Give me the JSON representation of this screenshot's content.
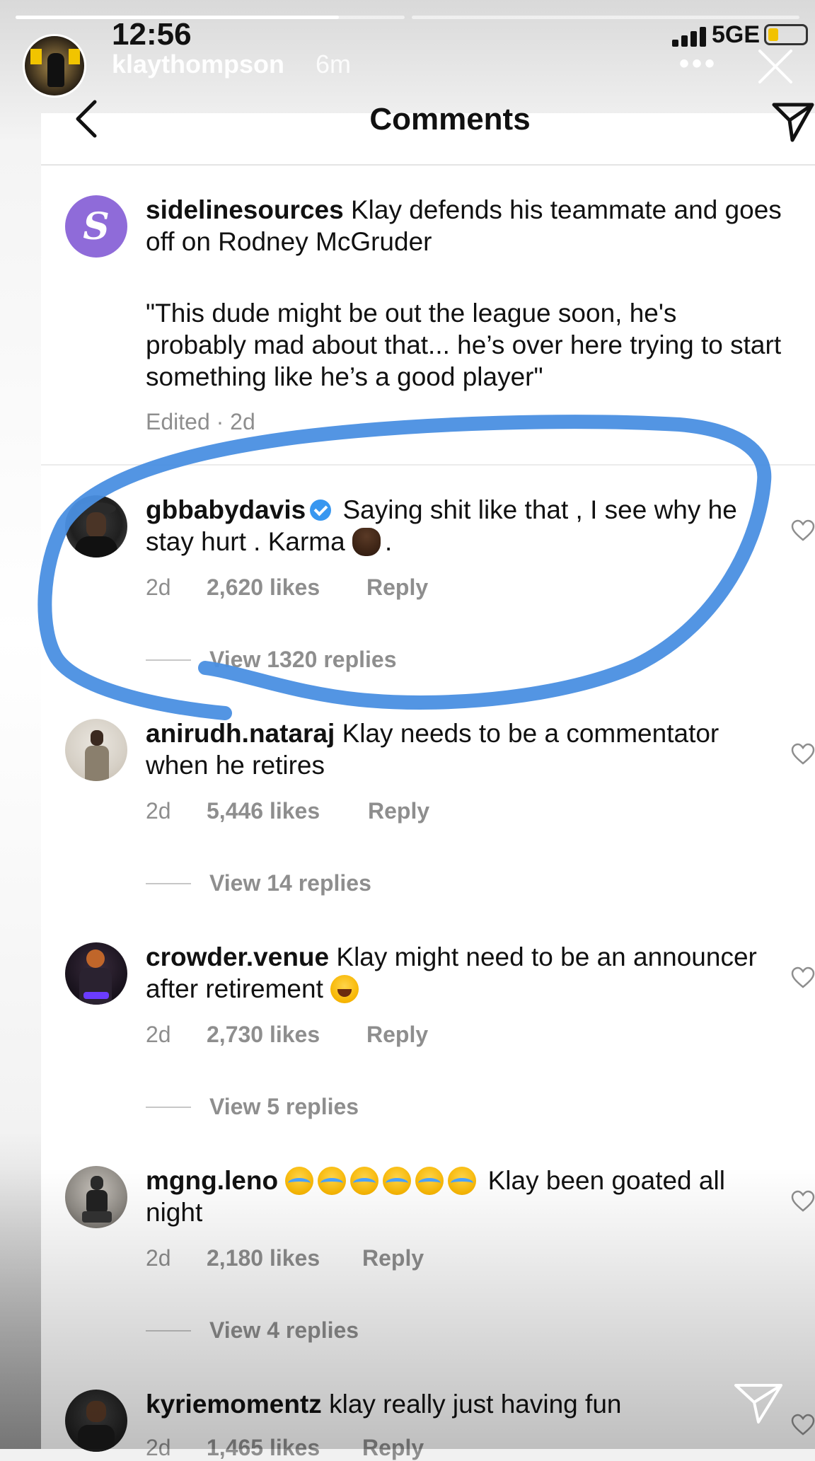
{
  "status_bar": {
    "time": "12:56",
    "network": "5GE"
  },
  "story": {
    "username": "klaythompson",
    "posted_ago": "6m",
    "more": "•••"
  },
  "screen": {
    "title": "Comments"
  },
  "caption": {
    "username": "sidelinesources",
    "text1": "Klay defends his teammate and goes off on Rodney McGruder",
    "text2": "\"This dude might be out the league soon, he's probably mad about that... he’s over here trying to start something like he’s a good player\"",
    "meta": "Edited · 2d"
  },
  "comments": [
    {
      "username": "gbbabydavis",
      "text": "Saying shit like that , I see why he stay hurt .  Karma",
      "text_end": ".",
      "age": "2d",
      "likes": "2,620 likes",
      "reply": "Reply",
      "view_replies": "View 1320 replies"
    },
    {
      "username": "anirudh.nataraj",
      "text": "Klay needs to be a commentator when he retires",
      "age": "2d",
      "likes": "5,446 likes",
      "reply": "Reply",
      "view_replies": "View 14 replies"
    },
    {
      "username": "crowder.venue",
      "text": "Klay might need to be an announcer after retirement",
      "age": "2d",
      "likes": "2,730 likes",
      "reply": "Reply",
      "view_replies": "View 5 replies"
    },
    {
      "username": "mgng.leno",
      "text": "Klay been goated all night",
      "age": "2d",
      "likes": "2,180 likes",
      "reply": "Reply",
      "view_replies": "View 4 replies"
    },
    {
      "username": "kyriemomentz",
      "text": "klay really just having fun",
      "age": "2d",
      "likes": "1,465 likes",
      "reply": "Reply"
    }
  ],
  "icons": {
    "back": "chevron-left-icon",
    "send": "paper-plane-icon",
    "heart": "heart-outline-icon",
    "close": "close-icon",
    "verified": "verified-badge-icon"
  },
  "colors": {
    "annotation": "#4a8fe2",
    "verified": "#3897f0",
    "meta_gray": "#8e8e8e"
  }
}
